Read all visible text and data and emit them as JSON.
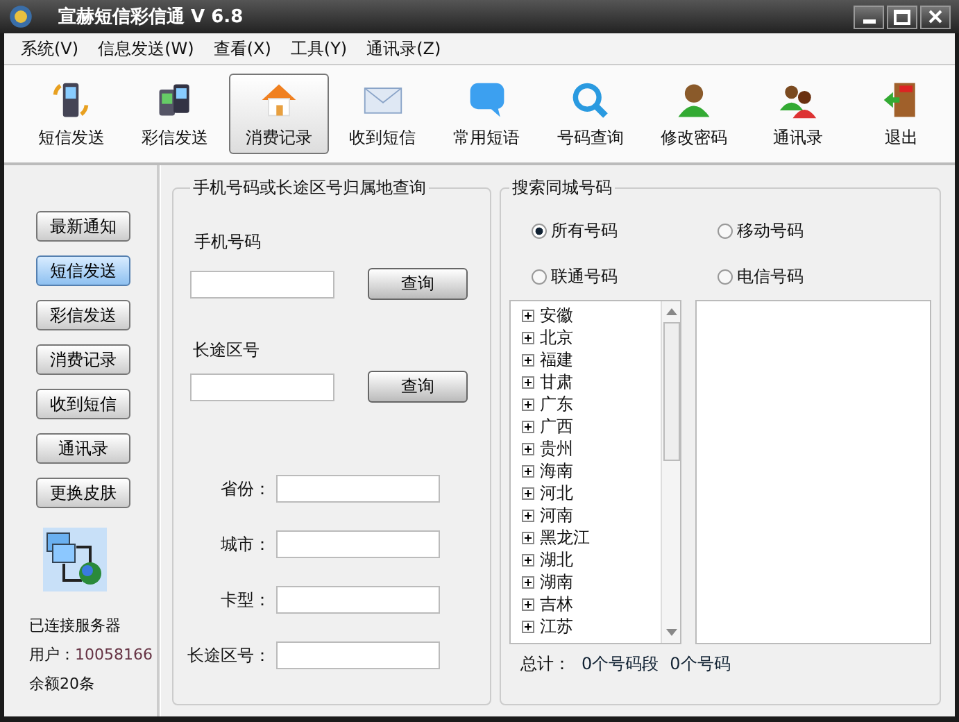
{
  "window": {
    "title": "宣赫短信彩信通 V 6.8"
  },
  "menu": [
    "系统(V)",
    "信息发送(W)",
    "查看(X)",
    "工具(Y)",
    "通讯录(Z)"
  ],
  "toolbar": [
    {
      "label": "短信发送",
      "selected": false
    },
    {
      "label": "彩信发送",
      "selected": false
    },
    {
      "label": "消费记录",
      "selected": true
    },
    {
      "label": "收到短信",
      "selected": false
    },
    {
      "label": "常用短语",
      "selected": false
    },
    {
      "label": "号码查询",
      "selected": false
    },
    {
      "label": "修改密码",
      "selected": false
    },
    {
      "label": "通讯录",
      "selected": false
    },
    {
      "label": "退出",
      "selected": false
    }
  ],
  "sidebar": {
    "buttons": [
      {
        "label": "最新通知",
        "selected": false
      },
      {
        "label": "短信发送",
        "selected": true
      },
      {
        "label": "彩信发送",
        "selected": false
      },
      {
        "label": "消费记录",
        "selected": false
      },
      {
        "label": "收到短信",
        "selected": false
      },
      {
        "label": "通讯录",
        "selected": false
      },
      {
        "label": "更换皮肤",
        "selected": false
      }
    ],
    "status": "已连接服务器",
    "user_label": "用户：",
    "user_id": "10058166",
    "balance": "余额20条"
  },
  "lookup": {
    "title": "手机号码或长途区号归属地查询",
    "phone_label": "手机号码",
    "phone_button": "查询",
    "area_label": "长途区号",
    "area_button": "查询",
    "results": [
      "省份：",
      "城市：",
      "卡型：",
      "长途区号："
    ]
  },
  "search": {
    "title": "搜索同城号码",
    "options": [
      {
        "label": "所有号码",
        "selected": true
      },
      {
        "label": "移动号码",
        "selected": false
      },
      {
        "label": "联通号码",
        "selected": false
      },
      {
        "label": "电信号码",
        "selected": false
      }
    ],
    "provinces": [
      "安徽",
      "北京",
      "福建",
      "甘肃",
      "广东",
      "广西",
      "贵州",
      "海南",
      "河北",
      "河南",
      "黑龙江",
      "湖北",
      "湖南",
      "吉林",
      "江苏"
    ],
    "total_label": "总计：",
    "segments": "0个号码段",
    "numbers": "0个号码"
  }
}
